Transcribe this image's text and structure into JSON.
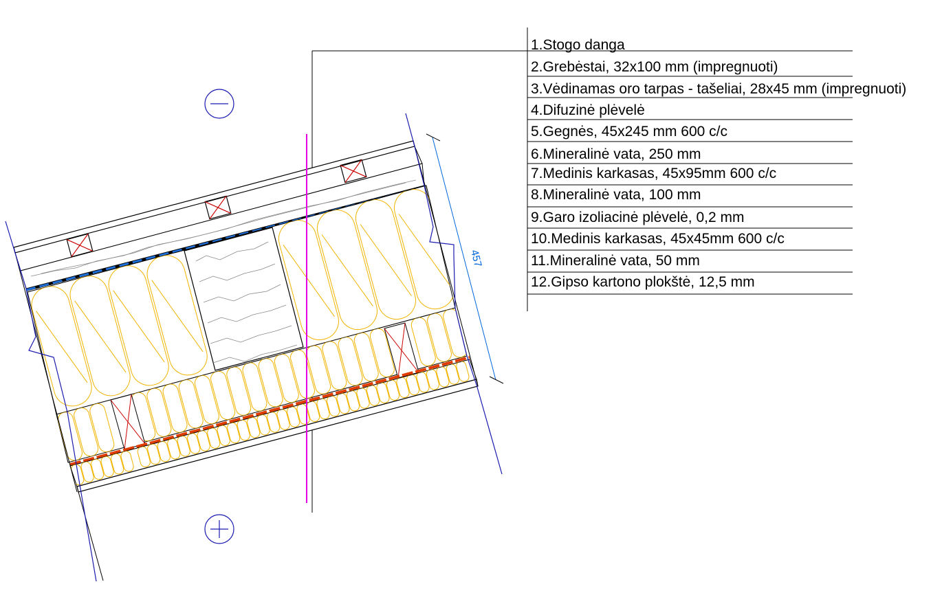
{
  "legend": {
    "items": [
      "1.Stogo danga",
      "2.Grebėstai, 32x100 mm (impregnuoti)",
      "3.Vėdinamas oro tarpas - tašeliai, 28x45 mm (impregnuoti)",
      "4.Difuzinė plėvelė",
      "5.Gegnės, 45x245 mm 600 c/c",
      "6.Mineralinė vata, 250 mm",
      "7.Medinis karkasas, 45x95mm 600 c/c",
      "8.Mineralinė vata, 100 mm",
      "9.Garo izoliacinė plėvelė, 0,2 mm",
      "10.Medinis karkasas, 45x45mm 600 c/c",
      "11.Mineralinė vata, 50 mm",
      "12.Gipso kartono plokštė, 12,5 mm"
    ]
  },
  "dimension": {
    "value": "457"
  },
  "symbols": {
    "exterior": "minus-sign",
    "interior": "plus-sign"
  },
  "colors": {
    "insulation": "#f0b400",
    "vapor_barrier": "#e03c00",
    "diffusion_membrane": "#1f6fd9",
    "section_line": "#e000e0",
    "dimension": "#0066dd",
    "break_line": "#1a1ab0"
  }
}
